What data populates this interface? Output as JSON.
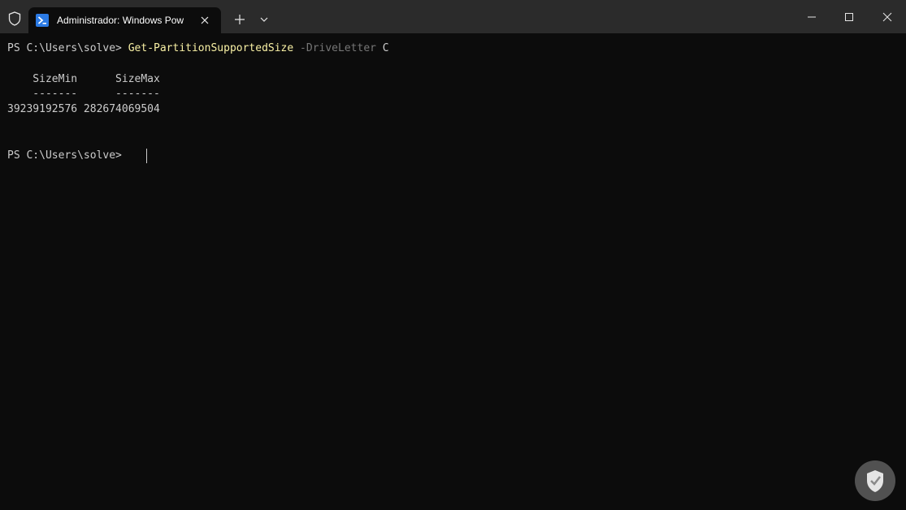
{
  "window": {
    "tab_title": "Administrador: Windows Pow"
  },
  "terminal": {
    "prompt1": "PS C:\\Users\\solve> ",
    "command": "Get-PartitionSupportedSize",
    "param": "-DriveLetter",
    "arg": "C",
    "header": "    SizeMin      SizeMax",
    "separator": "    -------      -------",
    "values": "39239192576 282674069504",
    "prompt2": "PS C:\\Users\\solve> "
  },
  "colors": {
    "background": "#0c0c0c",
    "titlebar": "#2b2b2b",
    "command": "#f9f1a5",
    "parameter": "#767676",
    "text": "#cccccc"
  },
  "icons": {
    "shield": "shield-icon",
    "powershell": "powershell-icon",
    "close": "close-icon",
    "new_tab": "plus-icon",
    "dropdown": "chevron-down-icon",
    "minimize": "minimize-icon",
    "maximize": "maximize-icon",
    "window_close": "close-icon",
    "watermark": "watermark-logo"
  }
}
